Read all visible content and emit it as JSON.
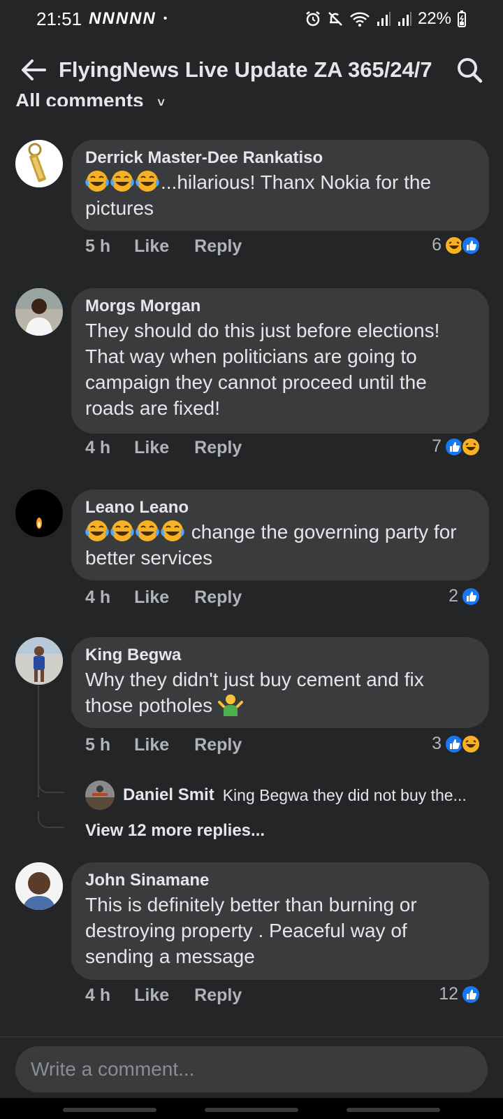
{
  "status_bar": {
    "time": "21:51",
    "notifications": "NNNNN",
    "dot": "•",
    "battery": "22%"
  },
  "header": {
    "title": "FlyingNews Live Update ZA 365/24/7",
    "back_icon": "arrow-left-icon",
    "search_icon": "search-icon"
  },
  "filter": {
    "label": "All comments",
    "chevron": "˅"
  },
  "comments": [
    {
      "author": "Derrick Master-Dee Rankatiso",
      "text": "...hilarious! Thanx Nokia for the pictures",
      "emoji_count": 3,
      "time": "5 h",
      "like": "Like",
      "reply": "Reply",
      "reaction_count": "6",
      "reactions": [
        "haha",
        "like"
      ]
    },
    {
      "author": "Morgs Morgan",
      "text": "They should do this just before elections! That way when politicians are going to campaign they cannot proceed until the roads are fixed!",
      "time": "4 h",
      "like": "Like",
      "reply": "Reply",
      "reaction_count": "7",
      "reactions": [
        "like",
        "haha"
      ]
    },
    {
      "author": "Leano Leano",
      "text": "change the governing party for better services",
      "emoji_count": 4,
      "time": "4 h",
      "like": "Like",
      "reply": "Reply",
      "reaction_count": "2",
      "reactions": [
        "like"
      ]
    },
    {
      "author": "King Begwa",
      "text": "Why they didn't just buy cement and fix those potholes",
      "trailing_emoji": "🤷‍♂️",
      "time": "5 h",
      "like": "Like",
      "reply": "Reply",
      "reaction_count": "3",
      "reactions": [
        "like",
        "haha"
      ],
      "reply_preview": {
        "author": "Daniel Smit",
        "text": "King Begwa they did not buy the..."
      },
      "view_more": "View 12 more replies..."
    },
    {
      "author": "John Sinamane",
      "text": "This is definitely better than burning or destroying property . Peaceful way of sending a message",
      "time": "4 h",
      "like": "Like",
      "reply": "Reply",
      "reaction_count": "12",
      "reactions": [
        "like"
      ]
    }
  ],
  "composer": {
    "placeholder": "Write a comment..."
  },
  "colors": {
    "background": "#242526",
    "bubble": "#3a3b3c",
    "like_blue": "#1877f2",
    "haha_yellow": "#f7b125",
    "meta_gray": "#b0b3b8"
  }
}
